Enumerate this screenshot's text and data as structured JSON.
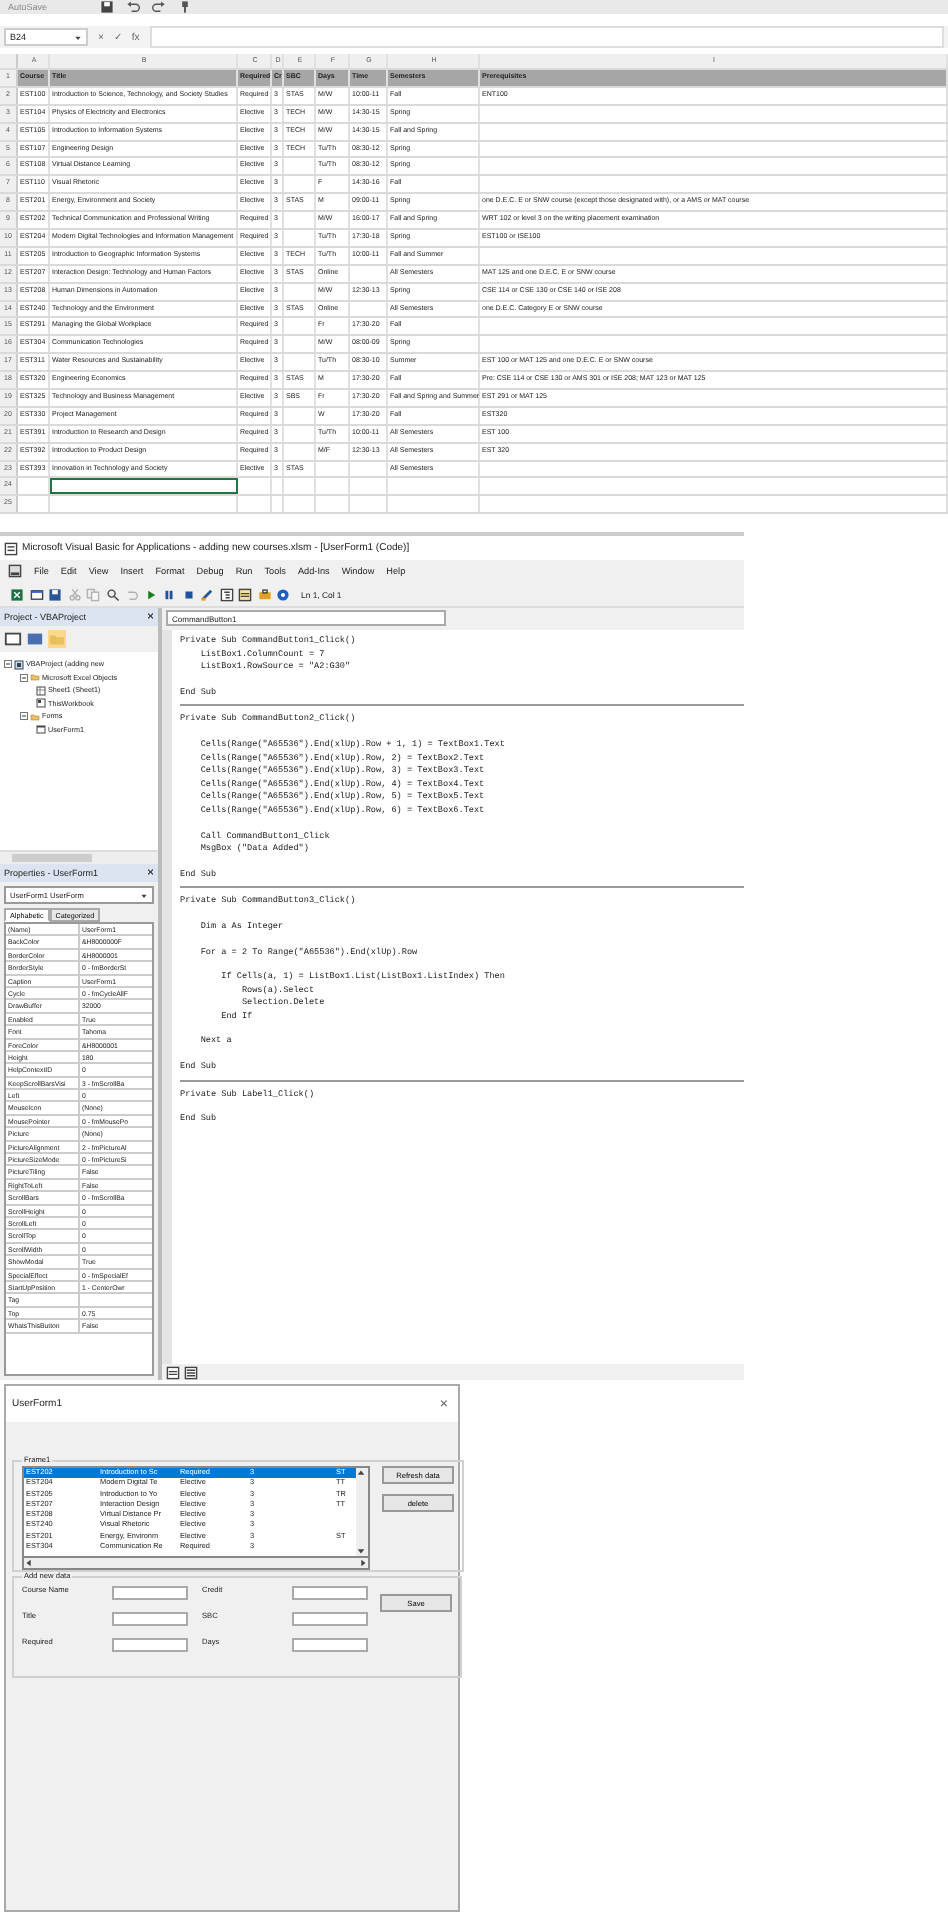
{
  "excel": {
    "autosave": "AutoSave",
    "name_box": "B24",
    "formula_marks": [
      "×",
      "✓",
      "fx"
    ],
    "columns": [
      {
        "letter": "A",
        "heading": "Course"
      },
      {
        "letter": "B",
        "heading": "Title"
      },
      {
        "letter": "C",
        "heading": "Required"
      },
      {
        "letter": "D",
        "heading": "Cr"
      },
      {
        "letter": "E",
        "heading": "SBC"
      },
      {
        "letter": "F",
        "heading": "Days"
      },
      {
        "letter": "G",
        "heading": "Time"
      },
      {
        "letter": "H",
        "heading": "Semesters"
      },
      {
        "letter": "I",
        "heading": "Prerequisites"
      }
    ],
    "header_row_number": "1",
    "rows": [
      {
        "number": "2",
        "course": "EST100",
        "title": "Introduction to Science, Technology, and Society Studies",
        "required": "Required",
        "credit": "3",
        "sbc": "STAS",
        "days": "M/W",
        "time": "10:00-11",
        "semesters": "Fall",
        "prerequisites": "ENT100"
      },
      {
        "number": "3",
        "course": "EST104",
        "title": "Physics of Electricity and Electronics",
        "required": "Elective",
        "credit": "3",
        "sbc": "TECH",
        "days": "M/W",
        "time": "14:30-15",
        "semesters": "Spring"
      },
      {
        "number": "4",
        "course": "EST105",
        "title": "Introduction to Information Systems",
        "required": "Elective",
        "credit": "3",
        "sbc": "TECH",
        "days": "M/W",
        "time": "14:30-15",
        "semesters": "Fall and Spring"
      },
      {
        "number": "5",
        "course": "EST107",
        "title": "Engineering Design",
        "required": "Elective",
        "credit": "3",
        "sbc": "TECH",
        "days": "Tu/Th",
        "time": "08:30-12",
        "semesters": "Spring"
      },
      {
        "number": "6",
        "course": "EST108",
        "title": "Virtual Distance Learning",
        "required": "Elective",
        "credit": "3",
        "days": "Tu/Th",
        "time": "08:30-12",
        "semesters": "Spring"
      },
      {
        "number": "7",
        "course": "EST110",
        "title": "Visual Rhetoric",
        "required": "Elective",
        "credit": "3",
        "days": "F",
        "time": "14:30-16",
        "semesters": "Fall"
      },
      {
        "number": "8",
        "course": "EST201",
        "title": "Energy, Environment and Society",
        "required": "Elective",
        "credit": "3",
        "sbc": "STAS",
        "days": "M",
        "time": "09:00-11",
        "semesters": "Spring",
        "prerequisites": "one D.E.C. E or SNW course (except those designated with), or a AMS or MAT course"
      },
      {
        "number": "9",
        "course": "EST202",
        "title": "Technical Communication and Professional Writing",
        "required": "Required",
        "credit": "3",
        "days": "M/W",
        "time": "16:00-17",
        "semesters": "Fall and Spring",
        "prerequisites": "WRT 102 or level 3 on the writing placement examination"
      },
      {
        "number": "10",
        "course": "EST204",
        "title": "Modern Digital Technologies and Information Management",
        "required": "Required",
        "credit": "3",
        "days": "Tu/Th",
        "time": "17:30-18",
        "semesters": "Spring",
        "prerequisites": "EST100 or ISE100"
      },
      {
        "number": "11",
        "course": "EST205",
        "title": "Introduction to Geographic Information Systems",
        "required": "Elective",
        "credit": "3",
        "sbc": "TECH",
        "days": "Tu/Th",
        "time": "10:00-11",
        "semesters": "Fall and Summer"
      },
      {
        "number": "12",
        "course": "EST207",
        "title": "Interaction Design: Technology and Human Factors",
        "required": "Elective",
        "credit": "3",
        "sbc": "STAS",
        "days": "Online",
        "semesters": "All Semesters",
        "prerequisites": "MAT 125 and one D.E.C. E or SNW course"
      },
      {
        "number": "13",
        "course": "EST208",
        "title": "Human Dimensions in Automation",
        "required": "Elective",
        "credit": "3",
        "days": "M/W",
        "time": "12:30-13",
        "semesters": "Spring",
        "prerequisites": "CSE 114 or CSE 130 or CSE 140 or ISE 208"
      },
      {
        "number": "14",
        "course": "EST240",
        "title": "Technology and the Environment",
        "required": "Elective",
        "credit": "3",
        "sbc": "STAS",
        "days": "Online",
        "semesters": "All Semesters",
        "prerequisites": "one D.E.C. Category E or SNW course"
      },
      {
        "number": "15",
        "course": "EST291",
        "title": "Managing the Global Workplace",
        "required": "Required",
        "credit": "3",
        "days": "Fr",
        "time": "17:30-20",
        "semesters": "Fall"
      },
      {
        "number": "16",
        "course": "EST304",
        "title": "Communication Technologies",
        "required": "Required",
        "credit": "3",
        "days": "M/W",
        "time": "08:00-09",
        "semesters": "Spring"
      },
      {
        "number": "17",
        "course": "EST311",
        "title": "Water Resources and Sustainability",
        "required": "Elective",
        "credit": "3",
        "days": "Tu/Th",
        "time": "08:30-10",
        "semesters": "Summer",
        "prerequisites": "EST 100 or MAT 125 and one D.E.C. E or SNW course"
      },
      {
        "number": "18",
        "course": "EST320",
        "title": "Engineering Economics",
        "required": "Required",
        "credit": "3",
        "sbc": "STAS",
        "days": "M",
        "time": "17:30-20",
        "semesters": "Fall",
        "prerequisites": "Pre: CSE 114 or CSE 130 or AMS 301 or ISE 208; MAT 123 or MAT 125"
      },
      {
        "number": "19",
        "course": "EST325",
        "title": "Technology and Business Management",
        "required": "Elective",
        "credit": "3",
        "sbc": "SBS",
        "days": "Fr",
        "time": "17:30-20",
        "semesters": "Fall and Spring and Summer",
        "prerequisites": "EST 291 or MAT 125"
      },
      {
        "number": "20",
        "course": "EST330",
        "title": "Project Management",
        "required": "Required",
        "credit": "3",
        "days": "W",
        "time": "17:30-20",
        "semesters": "Fall",
        "prerequisites": "EST320"
      },
      {
        "number": "21",
        "course": "EST391",
        "title": "Introduction to Research and Design",
        "required": "Required",
        "credit": "3",
        "days": "Tu/Th",
        "time": "10:00-11",
        "semesters": "All Semesters",
        "prerequisites": "EST 100"
      },
      {
        "number": "22",
        "course": "EST392",
        "title": "Introduction to Product Design",
        "required": "Required",
        "credit": "3",
        "days": "M/F",
        "time": "12:30-13",
        "semesters": "All Semesters",
        "prerequisites": "EST 320"
      },
      {
        "number": "23",
        "course": "EST393",
        "title": "Innovation in Technology and Society",
        "required": "Elective",
        "credit": "3",
        "sbc": "STAS",
        "semesters": "All Semesters"
      }
    ],
    "empty_rows": [
      {
        "number": "24",
        "selected": true
      },
      {
        "number": "25",
        "selected": false
      }
    ]
  },
  "vba": {
    "window_title": "Microsoft Visual Basic for Applications - adding new courses.xlsm - [UserForm1 (Code)]",
    "menu": [
      "File",
      "Edit",
      "View",
      "Insert",
      "Format",
      "Debug",
      "Run",
      "Tools",
      "Add-Ins",
      "Window",
      "Help"
    ],
    "cursor_position": "Ln 1, Col 1",
    "project": {
      "title": "Project - VBAProject",
      "close": "×",
      "tree": [
        {
          "label": "VBAProject (adding new",
          "kind": "project",
          "expanded": true,
          "children": [
            {
              "label": "Microsoft Excel Objects",
              "kind": "folder",
              "expanded": true,
              "children": [
                {
                  "label": "Sheet1 (Sheet1)",
                  "kind": "sheet"
                },
                {
                  "label": "ThisWorkbook",
                  "kind": "workbook"
                }
              ]
            },
            {
              "label": "Forms",
              "kind": "folder",
              "expanded": true,
              "children": [
                {
                  "label": "UserForm1",
                  "kind": "form"
                }
              ]
            }
          ]
        }
      ]
    },
    "properties": {
      "title": "Properties - UserForm1",
      "close": "×",
      "object": "UserForm1 UserForm",
      "tabs": [
        {
          "label": "Alphabetic",
          "selected": true
        },
        {
          "label": "Categorized",
          "selected": false
        }
      ],
      "rows": [
        {
          "name": "(Name)",
          "value": "UserForm1"
        },
        {
          "name": "BackColor",
          "value": "&H8000000F"
        },
        {
          "name": "BorderColor",
          "value": "&H8000001"
        },
        {
          "name": "BorderStyle",
          "value": "0 - fmBorderSt"
        },
        {
          "name": "Caption",
          "value": "UserForm1"
        },
        {
          "name": "Cycle",
          "value": "0 - fmCycleAllF"
        },
        {
          "name": "DrawBuffer",
          "value": "32000"
        },
        {
          "name": "Enabled",
          "value": "True"
        },
        {
          "name": "Font",
          "value": "Tahoma"
        },
        {
          "name": "ForeColor",
          "value": "&H8000001"
        },
        {
          "name": "Height",
          "value": "180"
        },
        {
          "name": "HelpContextID",
          "value": "0"
        },
        {
          "name": "KeepScrollBarsVisi",
          "value": "3 - fmScrollBa"
        },
        {
          "name": "Left",
          "value": "0"
        },
        {
          "name": "MouseIcon",
          "value": "(None)"
        },
        {
          "name": "MousePointer",
          "value": "0 - fmMousePo"
        },
        {
          "name": "Picture",
          "value": "(None)"
        },
        {
          "name": "PictureAlignment",
          "value": "2 - fmPictureAl"
        },
        {
          "name": "PictureSizeMode",
          "value": "0 - fmPictureSi"
        },
        {
          "name": "PictureTiling",
          "value": "False"
        },
        {
          "name": "RightToLeft",
          "value": "False"
        },
        {
          "name": "ScrollBars",
          "value": "0 - fmScrollBa"
        },
        {
          "name": "ScrollHeight",
          "value": "0"
        },
        {
          "name": "ScrollLeft",
          "value": "0"
        },
        {
          "name": "ScrollTop",
          "value": "0"
        },
        {
          "name": "ScrollWidth",
          "value": "0"
        },
        {
          "name": "ShowModal",
          "value": "True"
        },
        {
          "name": "SpecialEffect",
          "value": "0 - fmSpecialEf"
        },
        {
          "name": "StartUpPosition",
          "value": "1 - CenterOwr"
        },
        {
          "name": "Tag"
        },
        {
          "name": "Top",
          "value": "0.75"
        },
        {
          "name": "WhatsThisButton",
          "value": "False"
        }
      ]
    },
    "code": {
      "object": "CommandButton1",
      "procedures": [
        {
          "blocks": [
            [
              "Private Sub CommandButton1_Click()",
              "    ListBox1.ColumnCount = 7",
              "    ListBox1.RowSource = \"A2:G30\""
            ],
            [
              "End Sub"
            ]
          ]
        },
        {
          "blocks": [
            [
              "Private Sub CommandButton2_Click()"
            ],
            [
              "    Cells(Range(\"A65536\").End(xlUp).Row + 1, 1) = TextBox1.Text",
              "    Cells(Range(\"A65536\").End(xlUp).Row, 2) = TextBox2.Text",
              "    Cells(Range(\"A65536\").End(xlUp).Row, 3) = TextBox3.Text",
              "    Cells(Range(\"A65536\").End(xlUp).Row, 4) = TextBox4.Text",
              "    Cells(Range(\"A65536\").End(xlUp).Row, 5) = TextBox5.Text",
              "    Cells(Range(\"A65536\").End(xlUp).Row, 6) = TextBox6.Text"
            ],
            [
              "    Call CommandButton1_Click",
              "    MsgBox (\"Data Added\")"
            ],
            [
              "End Sub"
            ]
          ]
        },
        {
          "blocks": [
            [
              "Private Sub CommandButton3_Click()"
            ],
            [
              "    Dim a As Integer"
            ],
            [
              "    For a = 2 To Range(\"A65536\").End(xlUp).Row"
            ],
            [
              "        If Cells(a, 1) = ListBox1.List(ListBox1.ListIndex) Then",
              "            Rows(a).Select",
              "            Selection.Delete",
              "        End If"
            ],
            [
              "    Next a"
            ],
            [
              "End Sub"
            ]
          ]
        },
        {
          "blocks": [
            [
              "Private Sub Label1_Click()"
            ],
            [
              "End Sub"
            ]
          ]
        }
      ]
    }
  },
  "userform": {
    "title": "UserForm1",
    "close": "×",
    "frame_label": "Frame1",
    "list": [
      {
        "cells": [
          "EST202",
          "Introduction to Sc",
          "Required",
          "3",
          "ST"
        ],
        "selected": true
      },
      {
        "cells": [
          "EST204",
          "Modern Digital Te",
          "Elective",
          "3",
          "TT"
        ],
        "selected": false
      },
      {
        "cells": [
          "EST205",
          "Introduction to Yo",
          "Elective",
          "3",
          "TR"
        ],
        "selected": false
      },
      {
        "cells": [
          "EST207",
          "Interaction Design",
          "Elective",
          "3",
          "TT"
        ],
        "selected": false
      },
      {
        "cells": [
          "EST208",
          "Virtual Distance Pr",
          "Elective",
          "3"
        ],
        "selected": false
      },
      {
        "cells": [
          "EST240",
          "Visual Rhetoric",
          "Elective",
          "3"
        ],
        "selected": false
      },
      {
        "cells": [
          "EST201",
          "Energy, Environm",
          "Elective",
          "3",
          "ST"
        ],
        "selected": false
      },
      {
        "cells": [
          "EST304",
          "Communication Re",
          "Required",
          "3"
        ],
        "selected": false
      }
    ],
    "buttons": [
      "Refresh data",
      "delete"
    ],
    "add_frame_label": "Add new data",
    "fields": [
      {
        "label": "Course Name"
      },
      {
        "label": "Credit"
      },
      {
        "label": "Title"
      },
      {
        "label": "SBC"
      },
      {
        "label": "Required"
      },
      {
        "label": "Days"
      }
    ],
    "save": "Save"
  }
}
